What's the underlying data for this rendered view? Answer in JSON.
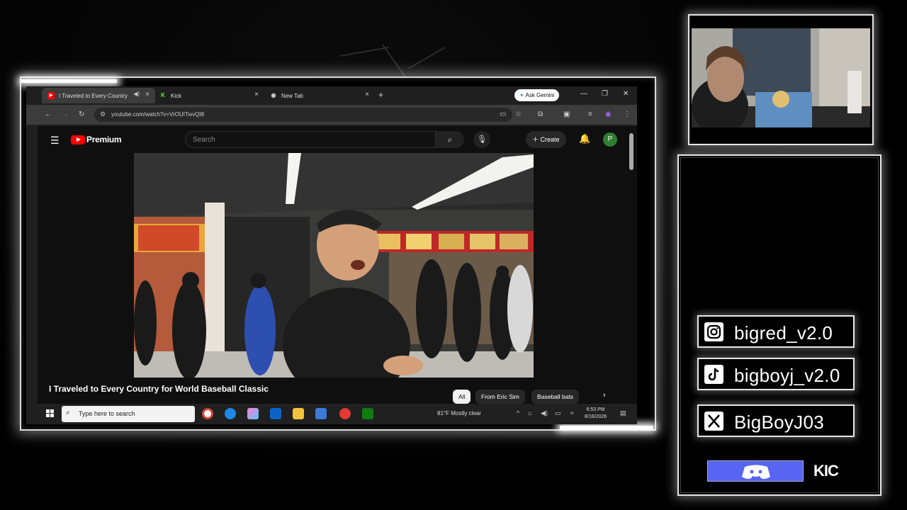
{
  "browser": {
    "tabs": [
      {
        "label": "I Traveled to Every Country",
        "active": true
      },
      {
        "label": "Kick",
        "active": false
      },
      {
        "label": "New Tab",
        "active": false
      }
    ],
    "new_tab_symbol": "+",
    "ask_gemini_label": "Ask Gemini",
    "url": "youtube.com/watch?v=VrOUITwvQt8"
  },
  "youtube": {
    "logo_text": "Premium",
    "search_placeholder": "Search",
    "create_label": "Create",
    "avatar_letter": "P",
    "video_title": "I Traveled to Every Country for World Baseball Classic",
    "chips": [
      "All",
      "From Eric Sim",
      "Baseball bats"
    ]
  },
  "taskbar": {
    "search_placeholder": "Type here to search",
    "weather": "81°F  Mostly clear",
    "time": "6:53 PM",
    "date": "8/16/2026"
  },
  "overlay": {
    "socials": [
      {
        "platform": "instagram",
        "handle": "bigred_v2.0"
      },
      {
        "platform": "tiktok",
        "handle": "bigboyj_v2.0"
      },
      {
        "platform": "x",
        "handle": "BigBoyJ03"
      }
    ],
    "kick_text": "KIC",
    "colors": {
      "discord": "#5865f2",
      "youtube_red": "#ff0000",
      "kick_green": "#53fc18"
    }
  }
}
